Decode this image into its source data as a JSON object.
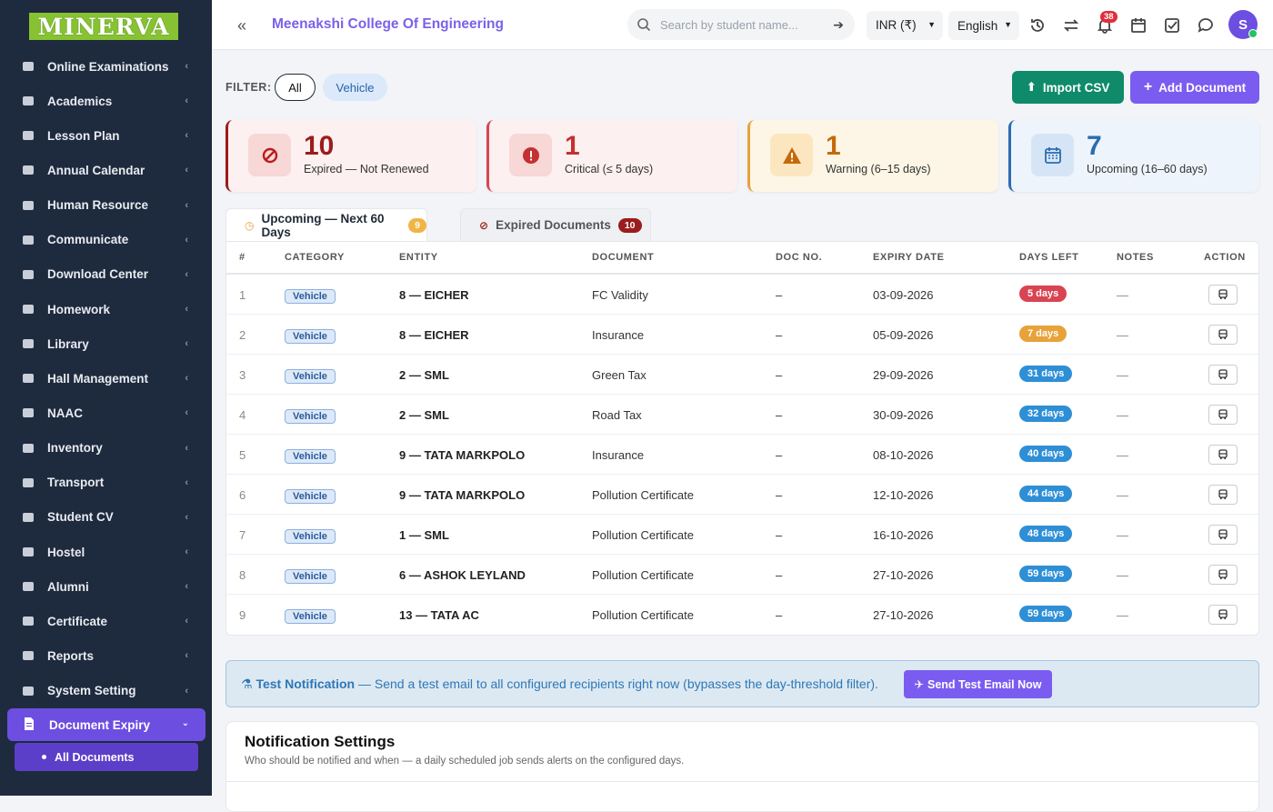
{
  "logo": "MINERVA",
  "sidebar": {
    "items": [
      {
        "label": "Online Examinations",
        "icon": "rss-icon"
      },
      {
        "label": "Academics",
        "icon": "graduation-cap-icon"
      },
      {
        "label": "Lesson Plan",
        "icon": "list-icon"
      },
      {
        "label": "Annual Calendar",
        "icon": "calendar-icon"
      },
      {
        "label": "Human Resource",
        "icon": "sitemap-icon"
      },
      {
        "label": "Communicate",
        "icon": "bullhorn-icon"
      },
      {
        "label": "Download Center",
        "icon": "download-icon"
      },
      {
        "label": "Homework",
        "icon": "flask-icon"
      },
      {
        "label": "Library",
        "icon": "book-icon"
      },
      {
        "label": "Hall Management",
        "icon": "book-icon"
      },
      {
        "label": "NAAC",
        "icon": "book-icon"
      },
      {
        "label": "Inventory",
        "icon": "inventory-icon"
      },
      {
        "label": "Transport",
        "icon": "bus-icon"
      },
      {
        "label": "Student CV",
        "icon": "cv-icon"
      },
      {
        "label": "Hostel",
        "icon": "building-icon"
      },
      {
        "label": "Alumni",
        "icon": "globe-icon"
      },
      {
        "label": "Certificate",
        "icon": "certificate-icon"
      },
      {
        "label": "Reports",
        "icon": "chart-line-icon"
      },
      {
        "label": "System Setting",
        "icon": "gears-icon"
      }
    ],
    "active": "Document Expiry",
    "sub_active": "All Documents"
  },
  "header": {
    "college": "Meenakshi College Of Engineering",
    "search_placeholder": "Search by student name...",
    "currency": "INR (₹)",
    "language": "English",
    "notif_count": "38",
    "avatar": "S"
  },
  "filter": {
    "label": "FILTER:",
    "all": "All",
    "vehicle": "Vehicle"
  },
  "buttons": {
    "import": "Import CSV",
    "add": "Add Document"
  },
  "cards": [
    {
      "num": "10",
      "label": "Expired — Not Renewed",
      "color": "#9b1c1c"
    },
    {
      "num": "1",
      "label": "Critical (≤ 5 days)",
      "color": "#c53030"
    },
    {
      "num": "1",
      "label": "Warning (6–15 days)",
      "color": "#c46a0a"
    },
    {
      "num": "7",
      "label": "Upcoming (16–60 days)",
      "color": "#2b6cb0"
    }
  ],
  "tabs": {
    "upcoming": "Upcoming — Next 60 Days",
    "upcoming_count": "9",
    "expired": "Expired Documents",
    "expired_count": "10"
  },
  "table": {
    "headers": [
      "#",
      "CATEGORY",
      "ENTITY",
      "DOCUMENT",
      "DOC NO.",
      "EXPIRY DATE",
      "DAYS LEFT",
      "NOTES",
      "ACTION"
    ],
    "rows": [
      {
        "idx": "1",
        "cat": "Vehicle",
        "entity": "8 — EICHER",
        "doc": "FC Validity",
        "docno": "–",
        "expiry": "03-09-2026",
        "days": "5 days",
        "color": "#d94452",
        "notes": "—"
      },
      {
        "idx": "2",
        "cat": "Vehicle",
        "entity": "8 — EICHER",
        "doc": "Insurance",
        "docno": "–",
        "expiry": "05-09-2026",
        "days": "7 days",
        "color": "#e8a23a",
        "notes": "—"
      },
      {
        "idx": "3",
        "cat": "Vehicle",
        "entity": "2 — SML",
        "doc": "Green Tax",
        "docno": "–",
        "expiry": "29-09-2026",
        "days": "31 days",
        "color": "#2e8fd6",
        "notes": "—"
      },
      {
        "idx": "4",
        "cat": "Vehicle",
        "entity": "2 — SML",
        "doc": "Road Tax",
        "docno": "–",
        "expiry": "30-09-2026",
        "days": "32 days",
        "color": "#2e8fd6",
        "notes": "—"
      },
      {
        "idx": "5",
        "cat": "Vehicle",
        "entity": "9 — TATA MARKPOLO",
        "doc": "Insurance",
        "docno": "–",
        "expiry": "08-10-2026",
        "days": "40 days",
        "color": "#2e8fd6",
        "notes": "—"
      },
      {
        "idx": "6",
        "cat": "Vehicle",
        "entity": "9 — TATA MARKPOLO",
        "doc": "Pollution Certificate",
        "docno": "–",
        "expiry": "12-10-2026",
        "days": "44 days",
        "color": "#2e8fd6",
        "notes": "—"
      },
      {
        "idx": "7",
        "cat": "Vehicle",
        "entity": "1 — SML",
        "doc": "Pollution Certificate",
        "docno": "–",
        "expiry": "16-10-2026",
        "days": "48 days",
        "color": "#2e8fd6",
        "notes": "—"
      },
      {
        "idx": "8",
        "cat": "Vehicle",
        "entity": "6 — ASHOK LEYLAND",
        "doc": "Pollution Certificate",
        "docno": "–",
        "expiry": "27-10-2026",
        "days": "59 days",
        "color": "#2e8fd6",
        "notes": "—"
      },
      {
        "idx": "9",
        "cat": "Vehicle",
        "entity": "13 — TATA AC",
        "doc": "Pollution Certificate",
        "docno": "–",
        "expiry": "27-10-2026",
        "days": "59 days",
        "color": "#2e8fd6",
        "notes": "—"
      }
    ]
  },
  "test": {
    "title": "Test Notification",
    "text": " — Send a test email to all configured recipients right now (bypasses the day-threshold filter).",
    "button": "Send Test Email Now"
  },
  "settings": {
    "title": "Notification Settings",
    "subtitle": "Who should be notified and when — a daily scheduled job sends alerts on the configured days."
  }
}
